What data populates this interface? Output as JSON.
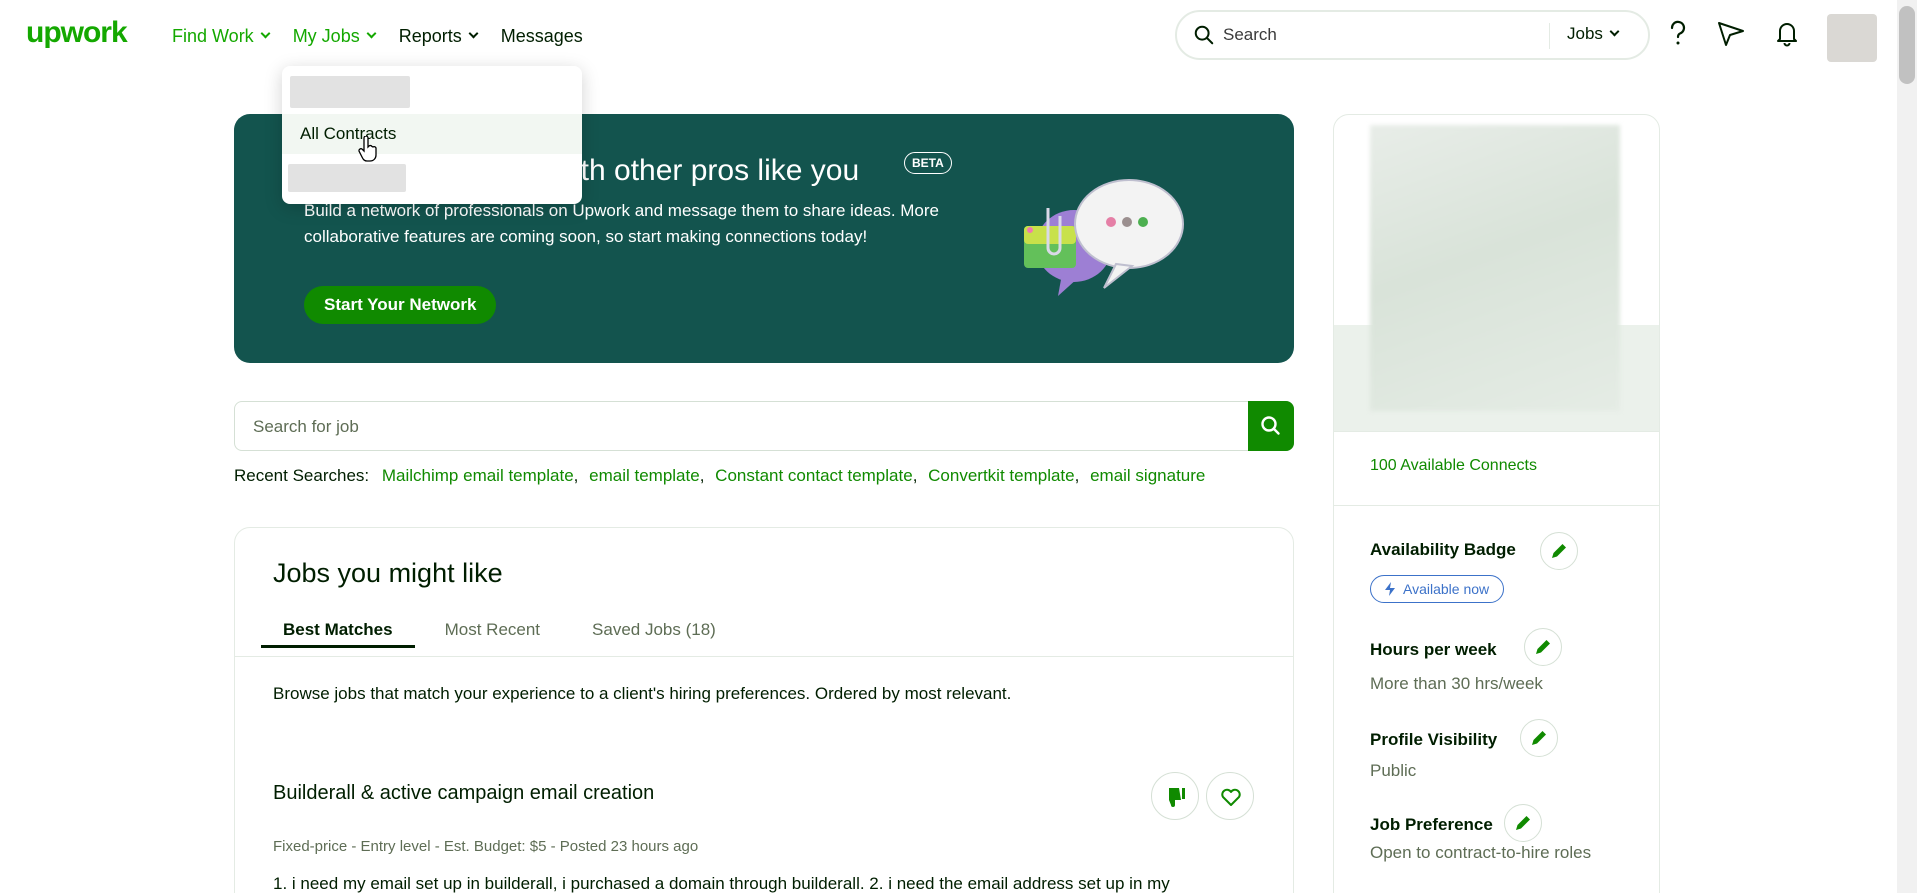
{
  "header": {
    "logo": "upwork",
    "nav": [
      {
        "label": "Find Work"
      },
      {
        "label": "My Jobs"
      },
      {
        "label": "Reports"
      },
      {
        "label": "Messages"
      }
    ],
    "search": {
      "placeholder": "Search",
      "type": "Jobs"
    }
  },
  "dropdown": {
    "item": "All Contracts"
  },
  "banner": {
    "title_visible": "ith other pros like you",
    "beta": "BETA",
    "description": "Build a network of professionals on Upwork and message them to share ideas. More collaborative features are coming soon, so start making connections today!",
    "button": "Start Your Network"
  },
  "job_search": {
    "placeholder": "Search for job"
  },
  "recent": {
    "label": "Recent Searches:",
    "items": [
      "Mailchimp email template",
      "email template",
      "Constant contact template",
      "Convertkit template",
      "email signature"
    ]
  },
  "jobs": {
    "title": "Jobs you might like",
    "tabs": [
      {
        "label": "Best Matches"
      },
      {
        "label": "Most Recent"
      },
      {
        "label": "Saved Jobs (18)"
      }
    ],
    "description": "Browse jobs that match your experience to a client's hiring preferences. Ordered by most relevant.",
    "first_job": {
      "title": "Builderall & active campaign email creation",
      "meta": "Fixed-price - Entry level - Est. Budget: $5 - Posted 23 hours ago",
      "desc": "1. i need my email set up in builderall, i purchased a domain through builderall. 2. i need the email address set up in my"
    }
  },
  "sidebar": {
    "connects": "100 Available Connects",
    "availability_label": "Availability Badge",
    "availability_value": "Available now",
    "hours_label": "Hours per week",
    "hours_value": "More than 30 hrs/week",
    "visibility_label": "Profile Visibility",
    "visibility_value": "Public",
    "preference_label": "Job Preference",
    "preference_value": "Open to contract-to-hire roles"
  },
  "colors": {
    "brand": "#14a800",
    "banner_bg": "#13544e",
    "button": "#108a00"
  }
}
